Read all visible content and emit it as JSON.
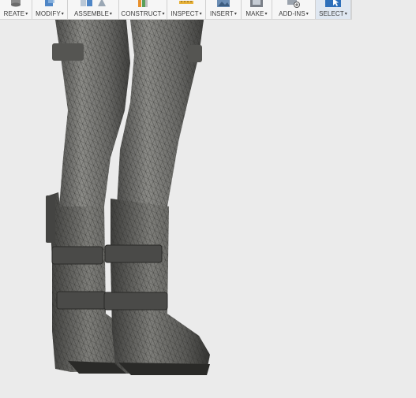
{
  "toolbar": {
    "groups": [
      {
        "label": "REATE",
        "icon": "create-icon"
      },
      {
        "label": "MODIFY",
        "icon": "modify-icon"
      },
      {
        "label": "ASSEMBLE",
        "icon": "assemble-icon"
      },
      {
        "label": "CONSTRUCT",
        "icon": "construct-icon"
      },
      {
        "label": "INSPECT",
        "icon": "inspect-icon"
      },
      {
        "label": "INSERT",
        "icon": "insert-icon"
      },
      {
        "label": "MAKE",
        "icon": "make-icon"
      },
      {
        "label": "ADD-INS",
        "icon": "add-ins-icon"
      },
      {
        "label": "SELECT",
        "icon": "select-icon"
      }
    ],
    "caret": "▾",
    "active_group": "SELECT"
  },
  "viewport": {
    "model": "mesh-legs-with-boots",
    "background_color": "#ebebeb",
    "mesh_color": "#6e6e6c",
    "wire_color": "#2c2c2a"
  }
}
